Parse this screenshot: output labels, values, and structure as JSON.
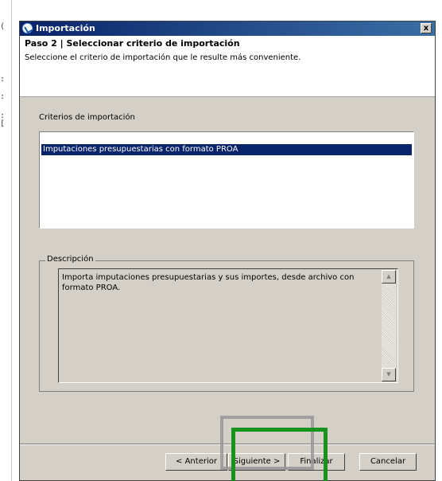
{
  "dialog": {
    "title": "Importación",
    "close_symbol": "x",
    "step_title": "Paso 2 | Seleccionar criterio de importación",
    "step_description": "Seleccione el criterio de importación que le resulte más conveniente."
  },
  "criteria": {
    "label": "Criterios de importación",
    "items": [
      "Imputaciones presupuestarias con formato PROA"
    ],
    "selected_index": 0
  },
  "description": {
    "legend": "Descripción",
    "text": "Importa imputaciones presupuestarias y sus importes, desde archivo con formato PROA."
  },
  "buttons": {
    "previous": "< Anterior",
    "next": "Siguiente >",
    "finish": "Finalizar",
    "cancel": "Cancelar"
  },
  "icons": {
    "title": "app-logo-icon",
    "scroll_up": "scroll-up-icon",
    "scroll_down": "scroll-down-icon"
  },
  "colors": {
    "titlebar": "#0a246a",
    "selection": "#0a246a",
    "dialog_bg": "#d4d0c8",
    "highlight_green": "#17921c"
  }
}
